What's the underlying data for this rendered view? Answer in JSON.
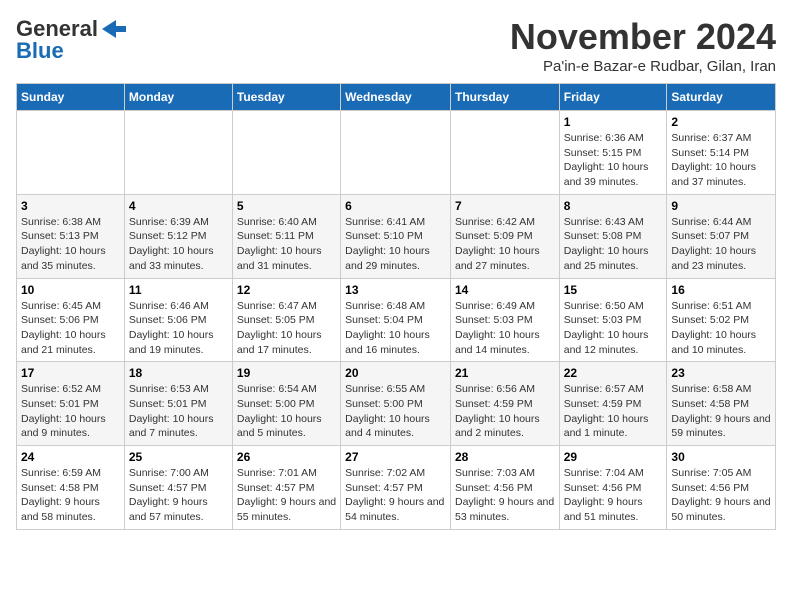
{
  "header": {
    "logo_general": "General",
    "logo_blue": "Blue",
    "month_title": "November 2024",
    "subtitle": "Pa'in-e Bazar-e Rudbar, Gilan, Iran"
  },
  "weekdays": [
    "Sunday",
    "Monday",
    "Tuesday",
    "Wednesday",
    "Thursday",
    "Friday",
    "Saturday"
  ],
  "weeks": [
    [
      {
        "day": "",
        "info": ""
      },
      {
        "day": "",
        "info": ""
      },
      {
        "day": "",
        "info": ""
      },
      {
        "day": "",
        "info": ""
      },
      {
        "day": "",
        "info": ""
      },
      {
        "day": "1",
        "info": "Sunrise: 6:36 AM\nSunset: 5:15 PM\nDaylight: 10 hours and 39 minutes."
      },
      {
        "day": "2",
        "info": "Sunrise: 6:37 AM\nSunset: 5:14 PM\nDaylight: 10 hours and 37 minutes."
      }
    ],
    [
      {
        "day": "3",
        "info": "Sunrise: 6:38 AM\nSunset: 5:13 PM\nDaylight: 10 hours and 35 minutes."
      },
      {
        "day": "4",
        "info": "Sunrise: 6:39 AM\nSunset: 5:12 PM\nDaylight: 10 hours and 33 minutes."
      },
      {
        "day": "5",
        "info": "Sunrise: 6:40 AM\nSunset: 5:11 PM\nDaylight: 10 hours and 31 minutes."
      },
      {
        "day": "6",
        "info": "Sunrise: 6:41 AM\nSunset: 5:10 PM\nDaylight: 10 hours and 29 minutes."
      },
      {
        "day": "7",
        "info": "Sunrise: 6:42 AM\nSunset: 5:09 PM\nDaylight: 10 hours and 27 minutes."
      },
      {
        "day": "8",
        "info": "Sunrise: 6:43 AM\nSunset: 5:08 PM\nDaylight: 10 hours and 25 minutes."
      },
      {
        "day": "9",
        "info": "Sunrise: 6:44 AM\nSunset: 5:07 PM\nDaylight: 10 hours and 23 minutes."
      }
    ],
    [
      {
        "day": "10",
        "info": "Sunrise: 6:45 AM\nSunset: 5:06 PM\nDaylight: 10 hours and 21 minutes."
      },
      {
        "day": "11",
        "info": "Sunrise: 6:46 AM\nSunset: 5:06 PM\nDaylight: 10 hours and 19 minutes."
      },
      {
        "day": "12",
        "info": "Sunrise: 6:47 AM\nSunset: 5:05 PM\nDaylight: 10 hours and 17 minutes."
      },
      {
        "day": "13",
        "info": "Sunrise: 6:48 AM\nSunset: 5:04 PM\nDaylight: 10 hours and 16 minutes."
      },
      {
        "day": "14",
        "info": "Sunrise: 6:49 AM\nSunset: 5:03 PM\nDaylight: 10 hours and 14 minutes."
      },
      {
        "day": "15",
        "info": "Sunrise: 6:50 AM\nSunset: 5:03 PM\nDaylight: 10 hours and 12 minutes."
      },
      {
        "day": "16",
        "info": "Sunrise: 6:51 AM\nSunset: 5:02 PM\nDaylight: 10 hours and 10 minutes."
      }
    ],
    [
      {
        "day": "17",
        "info": "Sunrise: 6:52 AM\nSunset: 5:01 PM\nDaylight: 10 hours and 9 minutes."
      },
      {
        "day": "18",
        "info": "Sunrise: 6:53 AM\nSunset: 5:01 PM\nDaylight: 10 hours and 7 minutes."
      },
      {
        "day": "19",
        "info": "Sunrise: 6:54 AM\nSunset: 5:00 PM\nDaylight: 10 hours and 5 minutes."
      },
      {
        "day": "20",
        "info": "Sunrise: 6:55 AM\nSunset: 5:00 PM\nDaylight: 10 hours and 4 minutes."
      },
      {
        "day": "21",
        "info": "Sunrise: 6:56 AM\nSunset: 4:59 PM\nDaylight: 10 hours and 2 minutes."
      },
      {
        "day": "22",
        "info": "Sunrise: 6:57 AM\nSunset: 4:59 PM\nDaylight: 10 hours and 1 minute."
      },
      {
        "day": "23",
        "info": "Sunrise: 6:58 AM\nSunset: 4:58 PM\nDaylight: 9 hours and 59 minutes."
      }
    ],
    [
      {
        "day": "24",
        "info": "Sunrise: 6:59 AM\nSunset: 4:58 PM\nDaylight: 9 hours and 58 minutes."
      },
      {
        "day": "25",
        "info": "Sunrise: 7:00 AM\nSunset: 4:57 PM\nDaylight: 9 hours and 57 minutes."
      },
      {
        "day": "26",
        "info": "Sunrise: 7:01 AM\nSunset: 4:57 PM\nDaylight: 9 hours and 55 minutes."
      },
      {
        "day": "27",
        "info": "Sunrise: 7:02 AM\nSunset: 4:57 PM\nDaylight: 9 hours and 54 minutes."
      },
      {
        "day": "28",
        "info": "Sunrise: 7:03 AM\nSunset: 4:56 PM\nDaylight: 9 hours and 53 minutes."
      },
      {
        "day": "29",
        "info": "Sunrise: 7:04 AM\nSunset: 4:56 PM\nDaylight: 9 hours and 51 minutes."
      },
      {
        "day": "30",
        "info": "Sunrise: 7:05 AM\nSunset: 4:56 PM\nDaylight: 9 hours and 50 minutes."
      }
    ]
  ]
}
